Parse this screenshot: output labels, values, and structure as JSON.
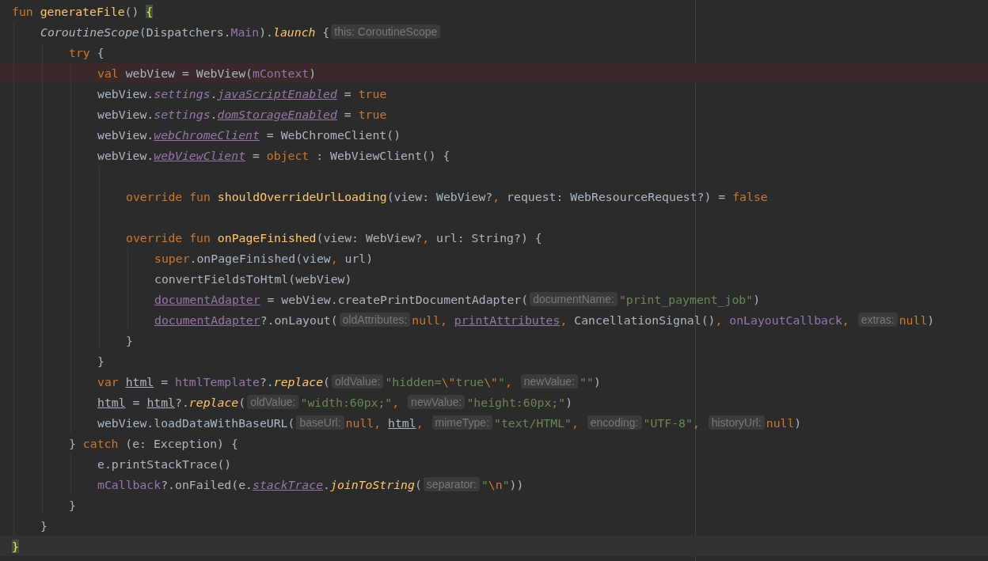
{
  "lines": [
    {
      "current": false,
      "error": false,
      "tokens": [
        {
          "kind": "keyword",
          "text": "fun "
        },
        {
          "kind": "function",
          "text": "generateFile"
        },
        {
          "kind": "plain",
          "text": "() "
        },
        {
          "kind": "brace",
          "text": "{"
        }
      ],
      "children": [
        {
          "current": false,
          "error": false,
          "tokens": [
            {
              "kind": "type-italic",
              "text": "CoroutineScope"
            },
            {
              "kind": "plain",
              "text": "(Dispatchers."
            },
            {
              "kind": "field",
              "text": "Main"
            },
            {
              "kind": "plain",
              "text": ")."
            },
            {
              "kind": "call",
              "text": "launch"
            },
            {
              "kind": "plain",
              "text": " {"
            },
            {
              "kind": "hint",
              "text": "this: CoroutineScope"
            }
          ],
          "children": [
            {
              "current": false,
              "error": false,
              "tokens": [
                {
                  "kind": "keyword",
                  "text": "try"
                },
                {
                  "kind": "plain",
                  "text": " {"
                }
              ],
              "children": [
                {
                  "current": false,
                  "error": true,
                  "tokens": [
                    {
                      "kind": "keyword",
                      "text": "val "
                    },
                    {
                      "kind": "plain",
                      "text": "webView = WebView("
                    },
                    {
                      "kind": "field",
                      "text": "mContext"
                    },
                    {
                      "kind": "plain",
                      "text": ")"
                    }
                  ]
                },
                {
                  "current": false,
                  "error": false,
                  "tokens": [
                    {
                      "kind": "plain",
                      "text": "webView."
                    },
                    {
                      "kind": "field-italic",
                      "text": "settings"
                    },
                    {
                      "kind": "plain",
                      "text": "."
                    },
                    {
                      "kind": "field-link",
                      "text": "javaScriptEnabled"
                    },
                    {
                      "kind": "plain",
                      "text": " = "
                    },
                    {
                      "kind": "keyword",
                      "text": "true"
                    }
                  ]
                },
                {
                  "current": false,
                  "error": false,
                  "tokens": [
                    {
                      "kind": "plain",
                      "text": "webView."
                    },
                    {
                      "kind": "field-italic",
                      "text": "settings"
                    },
                    {
                      "kind": "plain",
                      "text": "."
                    },
                    {
                      "kind": "field-link",
                      "text": "domStorageEnabled"
                    },
                    {
                      "kind": "plain",
                      "text": " = "
                    },
                    {
                      "kind": "keyword",
                      "text": "true"
                    }
                  ]
                },
                {
                  "current": false,
                  "error": false,
                  "tokens": [
                    {
                      "kind": "plain",
                      "text": "webView."
                    },
                    {
                      "kind": "field-link",
                      "text": "webChromeClient"
                    },
                    {
                      "kind": "plain",
                      "text": " = WebChromeClient()"
                    }
                  ]
                },
                {
                  "current": false,
                  "error": false,
                  "tokens": [
                    {
                      "kind": "plain",
                      "text": "webView."
                    },
                    {
                      "kind": "field-link",
                      "text": "webViewClient"
                    },
                    {
                      "kind": "plain",
                      "text": " = "
                    },
                    {
                      "kind": "keyword",
                      "text": "object"
                    },
                    {
                      "kind": "plain",
                      "text": " : WebViewClient() {"
                    }
                  ],
                  "children": [
                    {
                      "current": false,
                      "error": false
                    },
                    {
                      "current": false,
                      "error": false,
                      "tokens": [
                        {
                          "kind": "keyword",
                          "text": "override fun "
                        },
                        {
                          "kind": "function",
                          "text": "shouldOverrideUrlLoading"
                        },
                        {
                          "kind": "plain",
                          "text": "(view: WebView?"
                        },
                        {
                          "kind": "keyword",
                          "text": ","
                        },
                        {
                          "kind": "plain",
                          "text": " request: WebResourceRequest?) = "
                        },
                        {
                          "kind": "keyword",
                          "text": "false"
                        }
                      ]
                    },
                    {
                      "current": false,
                      "error": false
                    },
                    {
                      "current": false,
                      "error": false,
                      "tokens": [
                        {
                          "kind": "keyword",
                          "text": "override fun "
                        },
                        {
                          "kind": "function",
                          "text": "onPageFinished"
                        },
                        {
                          "kind": "plain",
                          "text": "(view: WebView?"
                        },
                        {
                          "kind": "keyword",
                          "text": ","
                        },
                        {
                          "kind": "plain",
                          "text": " url: String?) {"
                        }
                      ],
                      "children": [
                        {
                          "current": false,
                          "error": false,
                          "tokens": [
                            {
                              "kind": "keyword",
                              "text": "super"
                            },
                            {
                              "kind": "plain",
                              "text": ".onPageFinished(view"
                            },
                            {
                              "kind": "keyword",
                              "text": ","
                            },
                            {
                              "kind": "plain",
                              "text": " url)"
                            }
                          ]
                        },
                        {
                          "current": false,
                          "error": false,
                          "tokens": [
                            {
                              "kind": "plain",
                              "text": "convertFieldsToHtml(webView)"
                            }
                          ]
                        },
                        {
                          "current": false,
                          "error": false,
                          "tokens": [
                            {
                              "kind": "field-underline",
                              "text": "documentAdapter"
                            },
                            {
                              "kind": "plain",
                              "text": " = webView.createPrintDocumentAdapter("
                            },
                            {
                              "kind": "hint",
                              "text": "documentName:"
                            },
                            {
                              "kind": "string",
                              "text": "\"print_payment_job\""
                            },
                            {
                              "kind": "plain",
                              "text": ")"
                            }
                          ]
                        },
                        {
                          "current": false,
                          "error": false,
                          "tokens": [
                            {
                              "kind": "field-underline",
                              "text": "documentAdapter"
                            },
                            {
                              "kind": "plain",
                              "text": "?.onLayout("
                            },
                            {
                              "kind": "hint",
                              "text": "oldAttributes:"
                            },
                            {
                              "kind": "keyword",
                              "text": "null, "
                            },
                            {
                              "kind": "field-underline",
                              "text": "printAttributes"
                            },
                            {
                              "kind": "keyword",
                              "text": ","
                            },
                            {
                              "kind": "plain",
                              "text": " CancellationSignal()"
                            },
                            {
                              "kind": "keyword",
                              "text": ", "
                            },
                            {
                              "kind": "field",
                              "text": "onLayoutCallback"
                            },
                            {
                              "kind": "keyword",
                              "text": ", "
                            },
                            {
                              "kind": "hint",
                              "text": "extras:"
                            },
                            {
                              "kind": "keyword",
                              "text": "null"
                            },
                            {
                              "kind": "plain",
                              "text": ")"
                            }
                          ]
                        }
                      ]
                    },
                    {
                      "current": false,
                      "error": false,
                      "tokens": [
                        {
                          "kind": "plain",
                          "text": "}"
                        }
                      ]
                    }
                  ]
                },
                {
                  "current": false,
                  "error": false,
                  "tokens": [
                    {
                      "kind": "plain",
                      "text": "}"
                    }
                  ]
                },
                {
                  "current": false,
                  "error": false,
                  "tokens": [
                    {
                      "kind": "keyword",
                      "text": "var "
                    },
                    {
                      "kind": "local-underline",
                      "text": "html"
                    },
                    {
                      "kind": "plain",
                      "text": " = "
                    },
                    {
                      "kind": "field",
                      "text": "htmlTemplate"
                    },
                    {
                      "kind": "plain",
                      "text": "?."
                    },
                    {
                      "kind": "call",
                      "text": "replace"
                    },
                    {
                      "kind": "plain",
                      "text": "("
                    },
                    {
                      "kind": "hint",
                      "text": "oldValue:"
                    },
                    {
                      "kind": "string",
                      "text": "\"hidden="
                    },
                    {
                      "kind": "escape",
                      "text": "\\\""
                    },
                    {
                      "kind": "string",
                      "text": "true"
                    },
                    {
                      "kind": "escape",
                      "text": "\\\""
                    },
                    {
                      "kind": "string",
                      "text": "\""
                    },
                    {
                      "kind": "keyword",
                      "text": ", "
                    },
                    {
                      "kind": "hint",
                      "text": "newValue:"
                    },
                    {
                      "kind": "string",
                      "text": "\"\""
                    },
                    {
                      "kind": "plain",
                      "text": ")"
                    }
                  ]
                },
                {
                  "current": false,
                  "error": false,
                  "tokens": [
                    {
                      "kind": "local-underline",
                      "text": "html"
                    },
                    {
                      "kind": "plain",
                      "text": " = "
                    },
                    {
                      "kind": "local-underline",
                      "text": "html"
                    },
                    {
                      "kind": "plain",
                      "text": "?."
                    },
                    {
                      "kind": "call",
                      "text": "replace"
                    },
                    {
                      "kind": "plain",
                      "text": "("
                    },
                    {
                      "kind": "hint",
                      "text": "oldValue:"
                    },
                    {
                      "kind": "string",
                      "text": "\"width:60px;\""
                    },
                    {
                      "kind": "keyword",
                      "text": ", "
                    },
                    {
                      "kind": "hint",
                      "text": "newValue:"
                    },
                    {
                      "kind": "string",
                      "text": "\"height:60px;\""
                    },
                    {
                      "kind": "plain",
                      "text": ")"
                    }
                  ]
                },
                {
                  "current": false,
                  "error": false,
                  "tokens": [
                    {
                      "kind": "plain",
                      "text": "webView.loadDataWithBaseURL("
                    },
                    {
                      "kind": "hint",
                      "text": "baseUrl:"
                    },
                    {
                      "kind": "keyword",
                      "text": "null, "
                    },
                    {
                      "kind": "local-underline",
                      "text": "html"
                    },
                    {
                      "kind": "keyword",
                      "text": ", "
                    },
                    {
                      "kind": "hint",
                      "text": "mimeType:"
                    },
                    {
                      "kind": "string",
                      "text": "\"text/HTML\""
                    },
                    {
                      "kind": "keyword",
                      "text": ", "
                    },
                    {
                      "kind": "hint",
                      "text": "encoding:"
                    },
                    {
                      "kind": "string",
                      "text": "\"UTF-8\""
                    },
                    {
                      "kind": "keyword",
                      "text": ", "
                    },
                    {
                      "kind": "hint",
                      "text": "historyUrl:"
                    },
                    {
                      "kind": "keyword",
                      "text": "null"
                    },
                    {
                      "kind": "plain",
                      "text": ")"
                    }
                  ]
                }
              ]
            },
            {
              "current": false,
              "error": false,
              "tokens": [
                {
                  "kind": "plain",
                  "text": "} "
                },
                {
                  "kind": "keyword",
                  "text": "catch"
                },
                {
                  "kind": "plain",
                  "text": " (e: Exception) {"
                }
              ],
              "children": [
                {
                  "current": false,
                  "error": false,
                  "tokens": [
                    {
                      "kind": "plain",
                      "text": "e.printStackTrace()"
                    }
                  ]
                },
                {
                  "current": false,
                  "error": false,
                  "tokens": [
                    {
                      "kind": "field",
                      "text": "mCallback"
                    },
                    {
                      "kind": "plain",
                      "text": "?.onFailed(e."
                    },
                    {
                      "kind": "field-link",
                      "text": "stackTrace"
                    },
                    {
                      "kind": "plain",
                      "text": "."
                    },
                    {
                      "kind": "call",
                      "text": "joinToString"
                    },
                    {
                      "kind": "plain",
                      "text": "("
                    },
                    {
                      "kind": "hint",
                      "text": "separator:"
                    },
                    {
                      "kind": "string",
                      "text": "\""
                    },
                    {
                      "kind": "escape",
                      "text": "\\n"
                    },
                    {
                      "kind": "string",
                      "text": "\""
                    },
                    {
                      "kind": "plain",
                      "text": "))"
                    }
                  ]
                }
              ]
            },
            {
              "current": false,
              "error": false,
              "tokens": [
                {
                  "kind": "plain",
                  "text": "}"
                }
              ]
            }
          ]
        },
        {
          "current": false,
          "error": false,
          "tokens": [
            {
              "kind": "plain",
              "text": "}"
            }
          ]
        }
      ]
    },
    {
      "current": true,
      "error": false,
      "tokens": [
        {
          "kind": "brace",
          "text": "}"
        }
      ]
    }
  ]
}
